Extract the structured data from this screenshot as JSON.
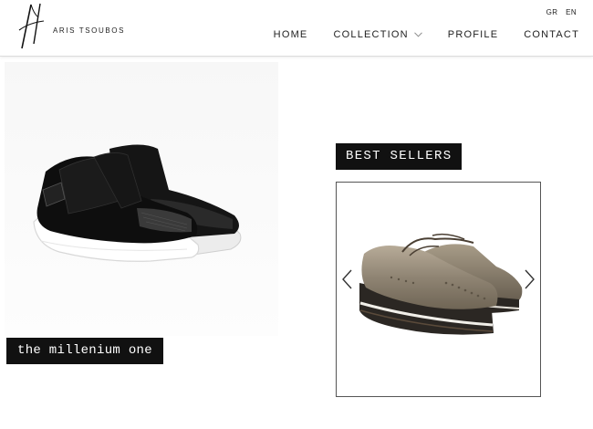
{
  "header": {
    "brand": "ARIS TSOUBOS",
    "languages": [
      "GR",
      "EN"
    ],
    "nav": [
      {
        "label": "HOME",
        "icon": null
      },
      {
        "label": "COLLECTION",
        "icon": "chevron-down-icon"
      },
      {
        "label": "PROFILE",
        "icon": null
      },
      {
        "label": "CONTACT",
        "icon": null
      }
    ]
  },
  "hero": {
    "caption": "the millenium one"
  },
  "best_sellers": {
    "title": "BEST SELLERS",
    "prev_icon": "chevron-left-icon",
    "next_icon": "chevron-right-icon"
  },
  "colors": {
    "caption_bg": "#111111",
    "caption_text": "#ffffff",
    "header_border": "#dcdcdc",
    "carousel_border": "#555555"
  }
}
